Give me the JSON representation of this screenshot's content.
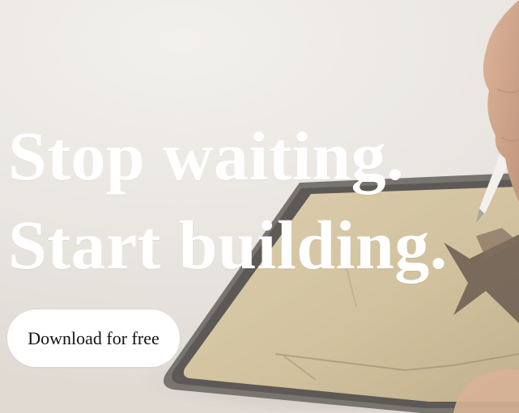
{
  "hero": {
    "headline_line_1": "Stop waiting.",
    "headline_line_2": "Start building.",
    "cta_label": "Download for free",
    "background_image": "tablet-with-stylus-photo"
  },
  "colors": {
    "headline_text": "#ffffff",
    "cta_background": "#ffffff",
    "cta_text": "#111111",
    "page_background": "#e9e5e0"
  }
}
